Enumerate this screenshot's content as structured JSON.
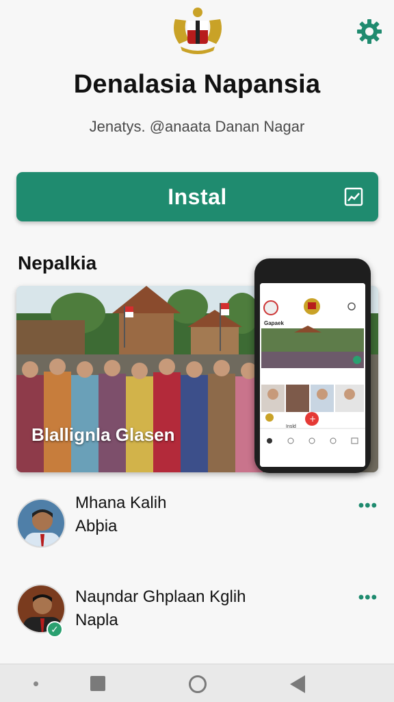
{
  "header": {
    "emblem_icon": "garuda-emblem-icon",
    "settings_icon": "gear-icon",
    "title": "Denalasia Napansia",
    "subtitle": "Jenatys. @anaata Danan Nagar"
  },
  "install_button": {
    "label": "Instal",
    "icon": "chart-icon"
  },
  "section": {
    "title": "Nepalkia"
  },
  "banner": {
    "caption": "Blallignla Glasen",
    "phone": {
      "label": "Gapaek",
      "tab_label": "Insld"
    }
  },
  "contacts": [
    {
      "name_line1": "Mhana Kalih",
      "name_line2": "Abþia",
      "more": "•••",
      "verified": false
    },
    {
      "name_line1": "Naɥndar Ghplaan Kglih",
      "name_line2": "Napla",
      "more": "•••",
      "verified": true
    }
  ],
  "colors": {
    "accent": "#1f8b6f",
    "background": "#f7f7f7"
  }
}
